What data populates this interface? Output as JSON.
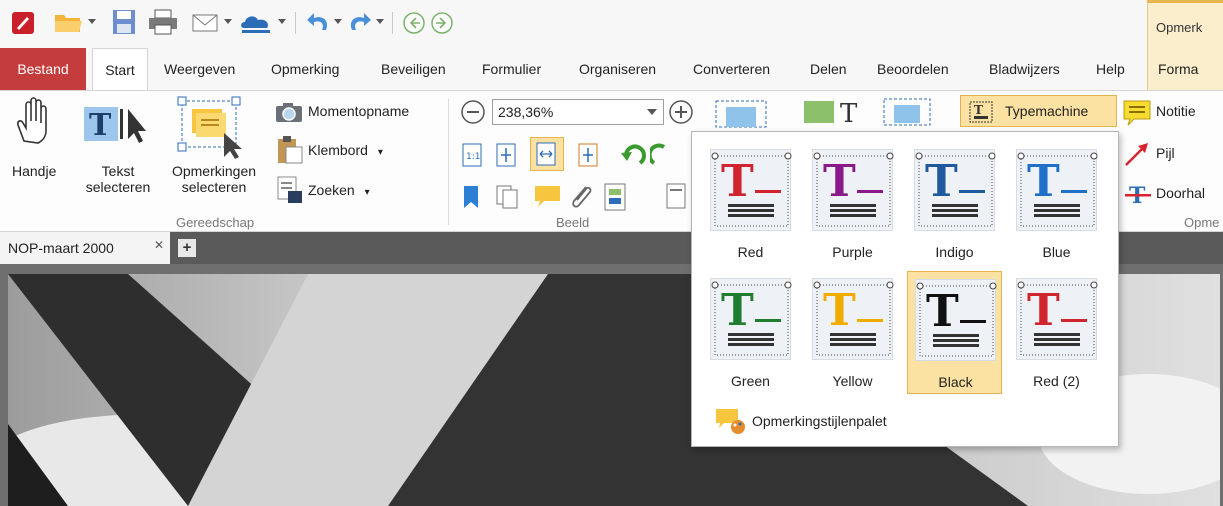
{
  "context_tab_top": "Opmerk",
  "tabs": [
    "Bestand",
    "Start",
    "Weergeven",
    "Opmerking",
    "Beveiligen",
    "Formulier",
    "Organiseren",
    "Converteren",
    "Delen",
    "Beoordelen",
    "Bladwijzers",
    "Help",
    "Forma"
  ],
  "ribbon": {
    "tools": {
      "hand": "Handje",
      "select_text_1": "Tekst",
      "select_text_2": "selecteren",
      "select_comments_1": "Opmerkingen",
      "select_comments_2": "selecteren",
      "snapshot": "Momentopname",
      "clipboard": "Klembord",
      "search": "Zoeken",
      "group_label": "Gereedschap"
    },
    "view": {
      "zoom_value": "238,36%",
      "group_label": "Beeld"
    },
    "comment": {
      "typewriter": "Typemachine",
      "note": "Notitie",
      "arrow": "Pijl",
      "strikeout": "Doorhal",
      "group_label": "Opme"
    }
  },
  "document_tab": "NOP-maart 2000",
  "styles": [
    {
      "label": "Red",
      "color": "#d0242f"
    },
    {
      "label": "Purple",
      "color": "#8a1a8a"
    },
    {
      "label": "Indigo",
      "color": "#1f5a9e"
    },
    {
      "label": "Blue",
      "color": "#1f70c8"
    },
    {
      "label": "Green",
      "color": "#1e7d2e"
    },
    {
      "label": "Yellow",
      "color": "#f0ad00"
    },
    {
      "label": "Black",
      "color": "#111111"
    },
    {
      "label": "Red (2)",
      "color": "#d0242f"
    }
  ],
  "selected_style": "Black",
  "palette_label": "Opmerkingstijlenpalet"
}
